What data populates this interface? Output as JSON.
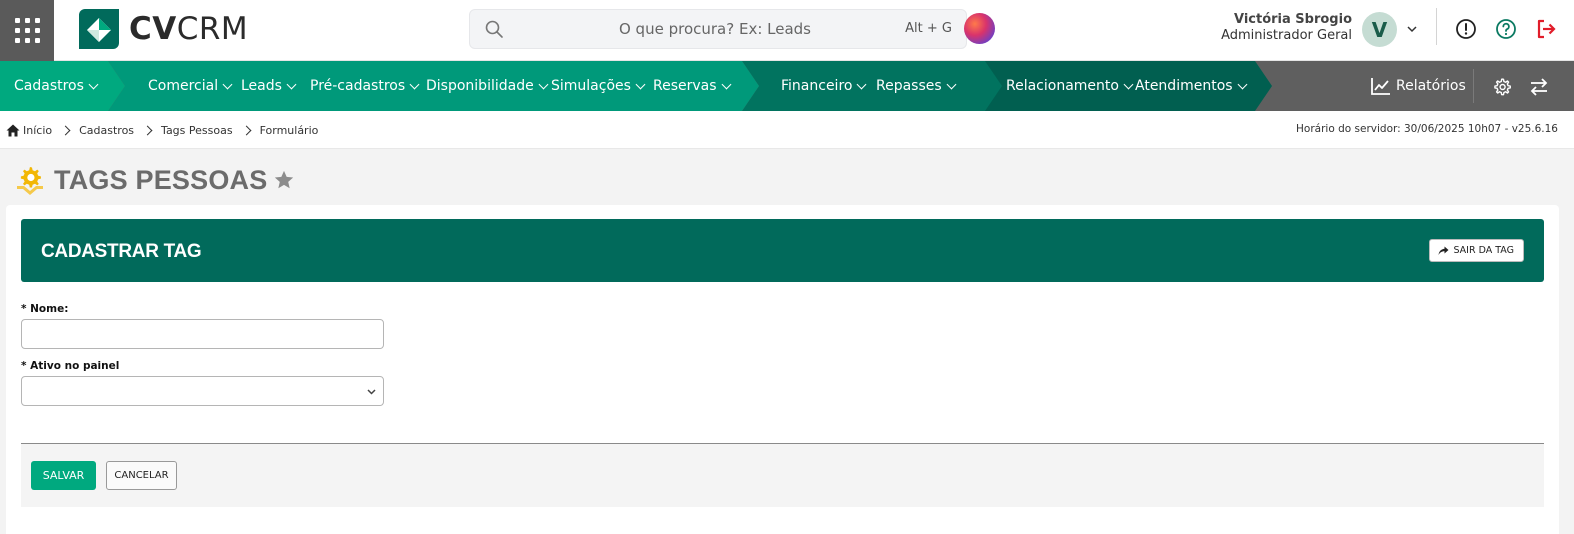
{
  "brand": {
    "name_bold": "CV",
    "name_light": "CRM"
  },
  "search": {
    "placeholder": "O que procura? Ex: Leads",
    "shortcut": "Alt + G"
  },
  "user": {
    "name": "Victória Sbrogio",
    "role": "Administrador Geral",
    "initial": "V"
  },
  "icons": {
    "apps": "apps-grid-icon",
    "search": "search-icon",
    "info": "info-icon",
    "help": "help-icon",
    "logout": "logout-icon",
    "reports": "chart-line-icon",
    "settings": "gear-icon",
    "switch": "arrows-swap-icon",
    "home": "home-icon",
    "star": "star-icon",
    "page": "tag-gear-icon",
    "share": "share-arrow-icon"
  },
  "colors": {
    "nav_green_light": "#00a97f",
    "nav_green_mid": "#00997a",
    "nav_green_dark": "#01735f",
    "nav_green_darker": "#015f50",
    "nav_gray": "#5f5f5f",
    "header_green": "#016a5b",
    "logout_red": "#e11d2a",
    "help_green": "#0b7a62"
  },
  "nav": {
    "cadastros": "Cadastros",
    "comercial": "Comercial",
    "leads": "Leads",
    "pre_cadastros": "Pré-cadastros",
    "disponibilidade": "Disponibilidade",
    "simulacoes": "Simulações",
    "reservas": "Reservas",
    "financeiro": "Financeiro",
    "repasses": "Repasses",
    "relacionamento": "Relacionamento",
    "atendimentos": "Atendimentos",
    "relatorios": "Relatórios"
  },
  "breadcrumb": {
    "inicio": "Início",
    "cadastros": "Cadastros",
    "tags_pessoas": "Tags Pessoas",
    "formulario": "Formulário"
  },
  "server_time": "Horário do servidor: 30/06/2025 10h07 - v25.6.16",
  "page": {
    "title": "TAGS PESSOAS"
  },
  "form": {
    "header_title": "CADASTRAR TAG",
    "exit_label": "SAIR DA TAG",
    "nome_label": "* Nome:",
    "nome_value": "",
    "ativo_label": "* Ativo no painel",
    "ativo_value": "",
    "save_label": "SALVAR",
    "cancel_label": "CANCELAR"
  }
}
